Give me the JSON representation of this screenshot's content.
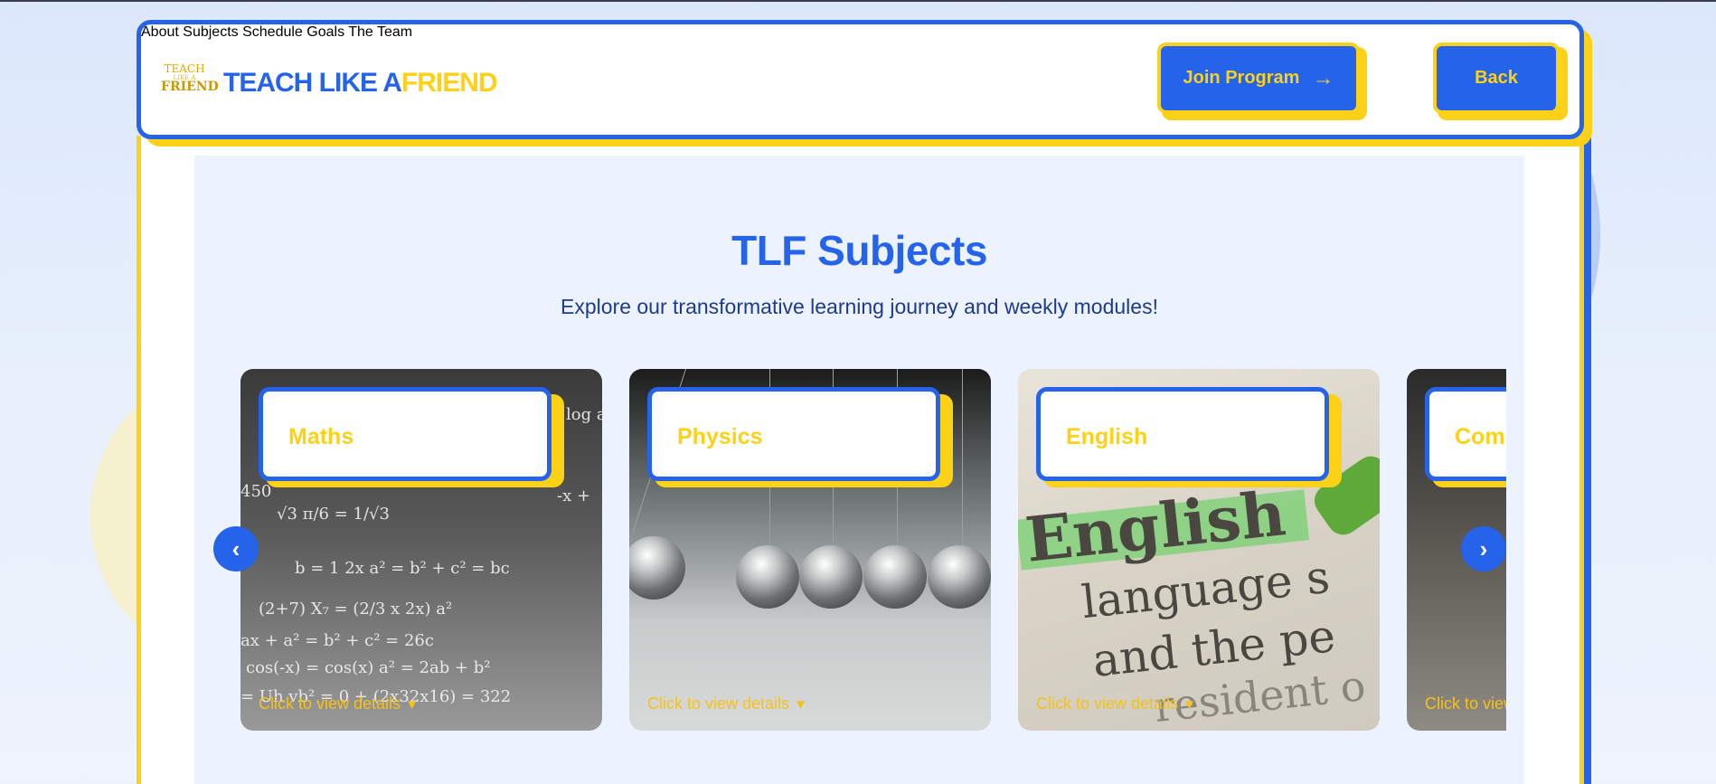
{
  "header": {
    "logo": {
      "line1": "TEACH",
      "line2": "LIKE A",
      "line3": "FRIEND"
    },
    "brand_primary": "TEACH LIKE A",
    "brand_accent": "FRIEND",
    "nav": [
      "About",
      "Subjects",
      "Schedule",
      "Goals",
      "The Team"
    ],
    "join_button": "Join Program",
    "back_button": "Back"
  },
  "section": {
    "title": "TLF Subjects",
    "subtitle": "Explore our transformative learning journey and weekly modules!"
  },
  "carousel": {
    "cta_text": "Click to view details",
    "cards": [
      {
        "title": "Maths",
        "image": "maths-chalkboard"
      },
      {
        "title": "Physics",
        "image": "newtons-cradle"
      },
      {
        "title": "English",
        "image": "english-dictionary"
      },
      {
        "title": "Com",
        "image": "computer-hands"
      }
    ],
    "prev_icon": "chevron-left-icon",
    "next_icon": "chevron-right-icon"
  },
  "colors": {
    "primary": "#2563eb",
    "accent": "#fcd116",
    "background": "#edf3fe"
  },
  "english_image_text": {
    "word1": "English",
    "word2": "language s",
    "word3": "and the pe",
    "word4": "resident o"
  }
}
